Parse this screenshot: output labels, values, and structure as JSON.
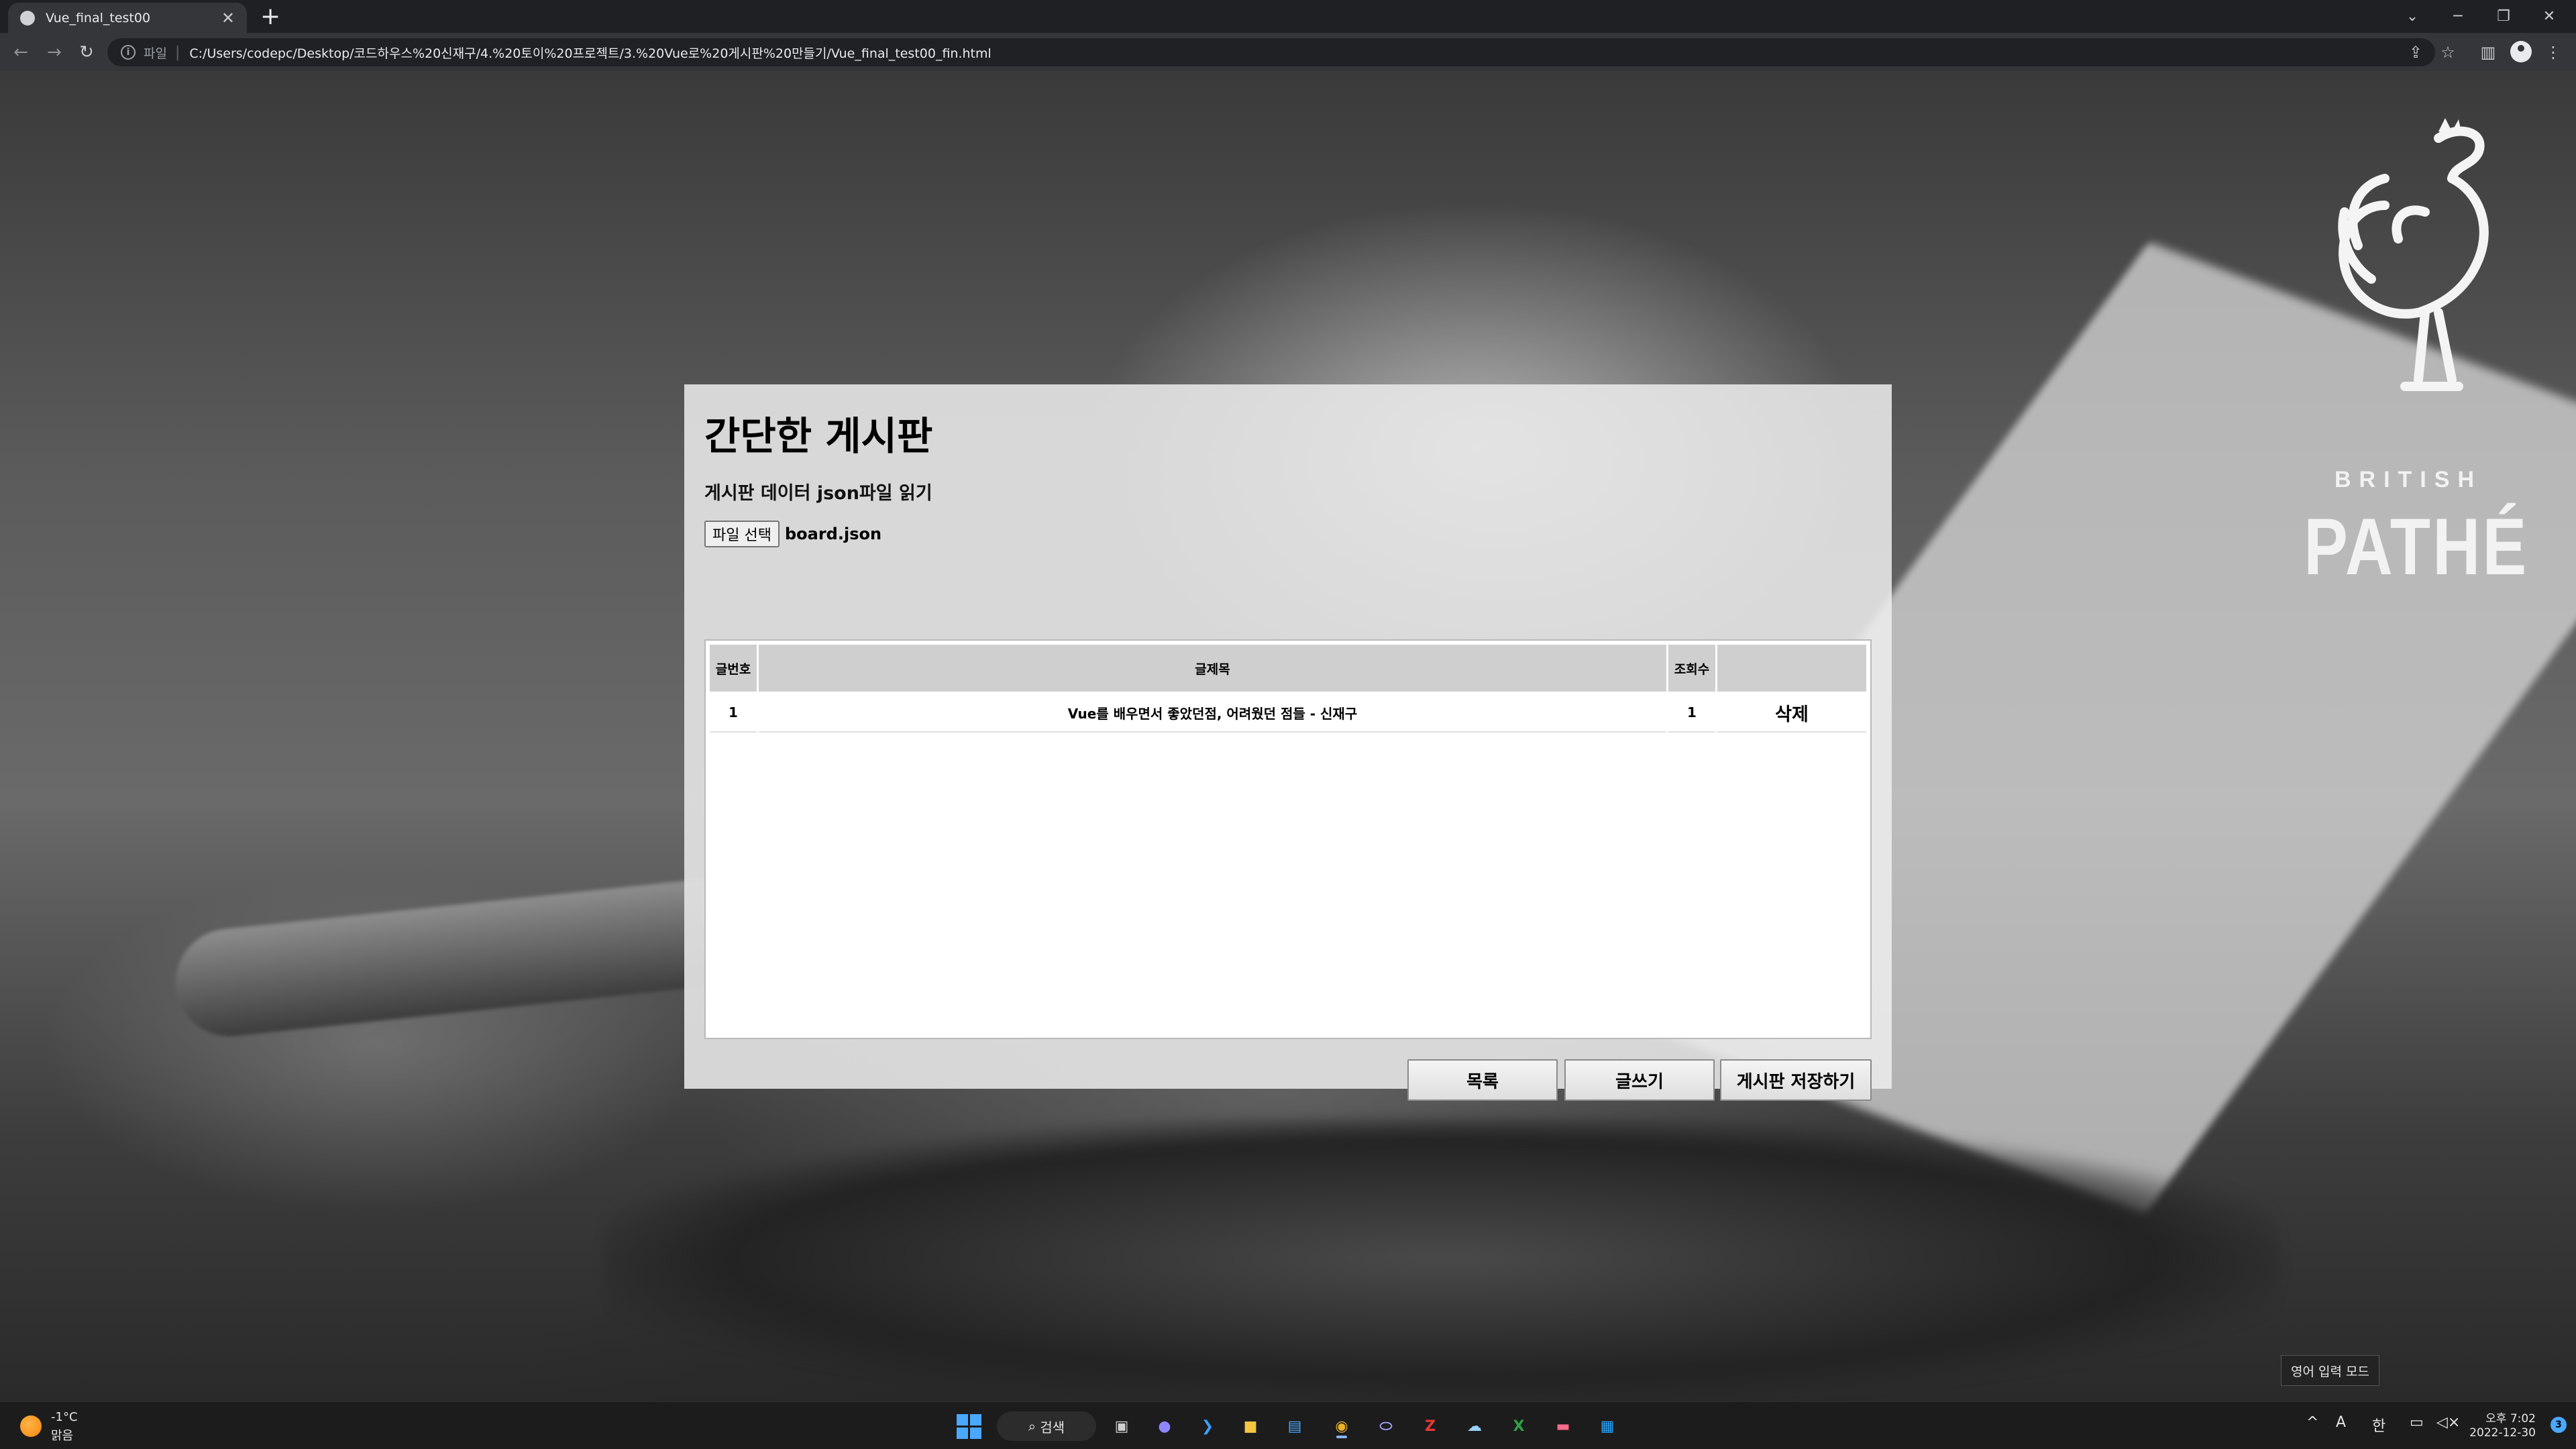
{
  "browser": {
    "tab_title": "Vue_final_test00",
    "scheme_label": "파일",
    "url": "C:/Users/codepc/Desktop/코드하우스%20신재구/4.%20토이%20프로젝트/3.%20Vue로%20게시판%20만들기/Vue_final_test00_fin.html"
  },
  "board": {
    "title": "간단한 게시판",
    "subtitle": "게시판 데이터 json파일 읽기",
    "file_button": "파일 선택",
    "file_name": "board.json",
    "columns": [
      "글번호",
      "글제목",
      "조회수",
      ""
    ],
    "rows": [
      {
        "no": "1",
        "title": "Vue를 배우면서 좋았던점, 어려웠던 점들 - 신재구",
        "views": "1",
        "action": "삭제"
      }
    ],
    "buttons": {
      "list": "목록",
      "write": "글쓰기",
      "save": "게시판 저장하기"
    }
  },
  "watermark": {
    "small": "BRITISH",
    "big": "PATHÉ"
  },
  "ime_tooltip": "영어 입력 모드",
  "taskbar": {
    "weather_temp": "-1°C",
    "weather_cond": "맑음",
    "search_label": "검색",
    "tray_ime_a": "A",
    "tray_ime_han": "한",
    "time": "오후 7:02",
    "date": "2022-12-30",
    "notif_count": "3"
  },
  "colors": {
    "accent": "#4aa8ff",
    "panel": "#e6e6e6",
    "header_cell": "#cfcfcf"
  }
}
